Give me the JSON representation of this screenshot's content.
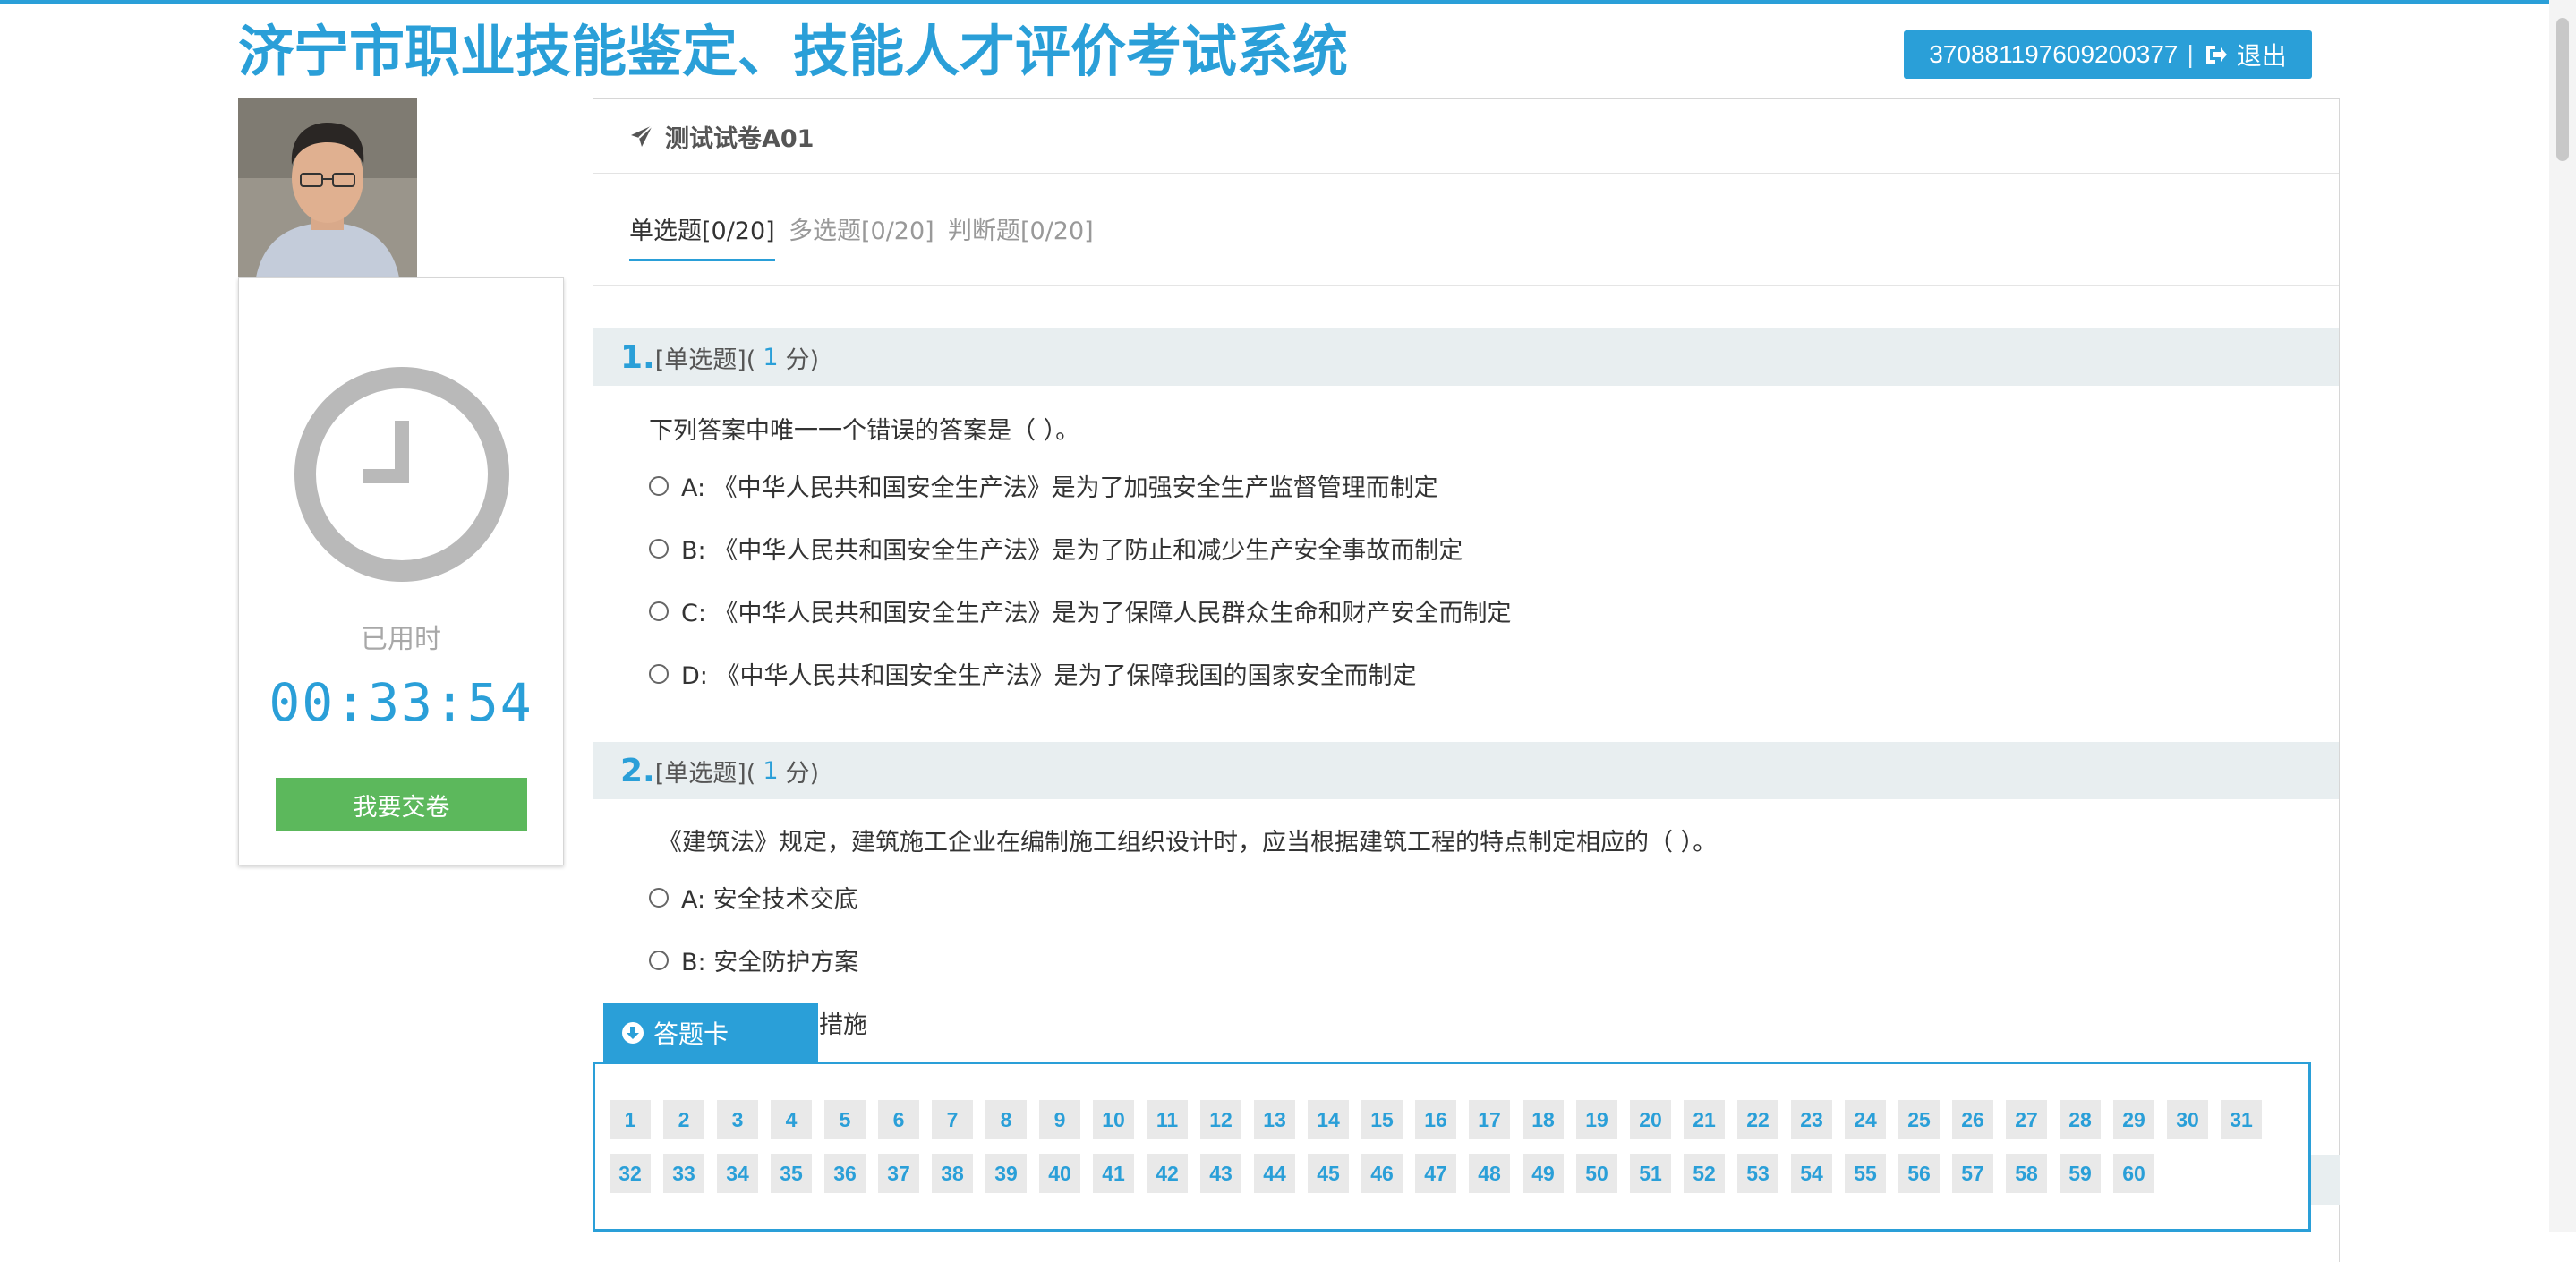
{
  "header": {
    "title": "济宁市职业技能鉴定、技能人才评价考试系统",
    "user_id": "370881197609200377",
    "separator": "|",
    "logout_label": "退出"
  },
  "sidebar": {
    "used_time_label": "已用时",
    "used_time": "00:33:54",
    "submit_label": "我要交卷"
  },
  "exam": {
    "paper_title": "测试试卷A01",
    "tabs": [
      {
        "label": "单选题[0/20]",
        "active": true
      },
      {
        "label": "多选题[0/20]",
        "active": false
      },
      {
        "label": "判断题[0/20]",
        "active": false
      }
    ],
    "questions": [
      {
        "number": "1.",
        "type": "[单选题](",
        "score": "1",
        "score_unit": "分)",
        "stem": "下列答案中唯一一个错误的答案是（ ）。",
        "options": [
          "A: 《中华人民共和国安全生产法》是为了加强安全生产监督管理而制定",
          "B: 《中华人民共和国安全生产法》是为了防止和减少生产安全事故而制定",
          "C: 《中华人民共和国安全生产法》是为了保障人民群众生命和财产安全而制定",
          "D: 《中华人民共和国安全生产法》是为了保障我国的国家安全而制定"
        ]
      },
      {
        "number": "2.",
        "type": "[单选题](",
        "score": "1",
        "score_unit": "分)",
        "stem": "《建筑法》规定，建筑施工企业在编制施工组织设计时，应当根据建筑工程的特点制定相应的（ ）。",
        "options": [
          "A: 安全技术交底",
          "B: 安全防护方案"
        ],
        "partial_option_text": "措施"
      }
    ]
  },
  "answer_card": {
    "label": "答题卡",
    "numbers": [
      "1",
      "2",
      "3",
      "4",
      "5",
      "6",
      "7",
      "8",
      "9",
      "10",
      "11",
      "12",
      "13",
      "14",
      "15",
      "16",
      "17",
      "18",
      "19",
      "20",
      "21",
      "22",
      "23",
      "24",
      "25",
      "26",
      "27",
      "28",
      "29",
      "30",
      "31",
      "32",
      "33",
      "34",
      "35",
      "36",
      "37",
      "38",
      "39",
      "40",
      "41",
      "42",
      "43",
      "44",
      "45",
      "46",
      "47",
      "48",
      "49",
      "50",
      "51",
      "52",
      "53",
      "54",
      "55",
      "56",
      "57",
      "58",
      "59",
      "60"
    ]
  },
  "colors": {
    "accent": "#2a9fd8",
    "submit": "#5cb85c",
    "question_header_bg": "#e8eef0"
  },
  "icons": {
    "logout": "sign-out-icon",
    "paper": "paper-plane-icon",
    "timer": "clock-icon",
    "answer_card": "arrow-circle-down-icon"
  }
}
